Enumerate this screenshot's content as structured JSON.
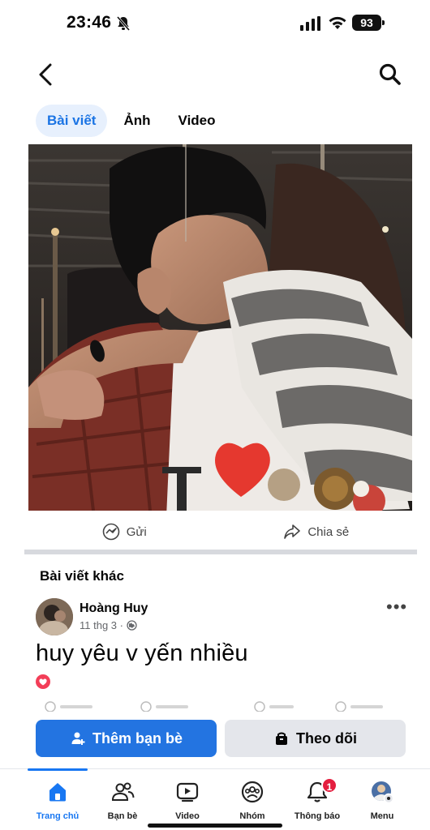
{
  "status_bar": {
    "time": "23:46",
    "battery": "93"
  },
  "tabs": [
    {
      "label": "Bài viết",
      "active": true
    },
    {
      "label": "Ảnh",
      "active": false
    },
    {
      "label": "Video",
      "active": false
    }
  ],
  "post_actions": {
    "send": "Gửi",
    "share": "Chia sẻ"
  },
  "section_title": "Bài viết khác",
  "post": {
    "author": "Hoàng Huy",
    "date": "11 thg 3 ·",
    "text": "huy yêu v yến nhiều"
  },
  "buttons": {
    "add_friend": "Thêm bạn bè",
    "follow": "Theo dõi"
  },
  "bottom_nav": {
    "items": [
      {
        "label": "Trang chủ",
        "icon": "home-icon"
      },
      {
        "label": "Bạn bè",
        "icon": "friends-icon"
      },
      {
        "label": "Video",
        "icon": "video-icon"
      },
      {
        "label": "Nhóm",
        "icon": "groups-icon"
      },
      {
        "label": "Thông báo",
        "icon": "bell-icon"
      },
      {
        "label": "Menu",
        "icon": "menu-avatar-icon"
      }
    ],
    "notification_badge": "1"
  },
  "colors": {
    "accent": "#1877f2",
    "primary_button": "#2374e1",
    "badge": "#e41e3f",
    "tab_active_bg": "#e7f0fd"
  }
}
